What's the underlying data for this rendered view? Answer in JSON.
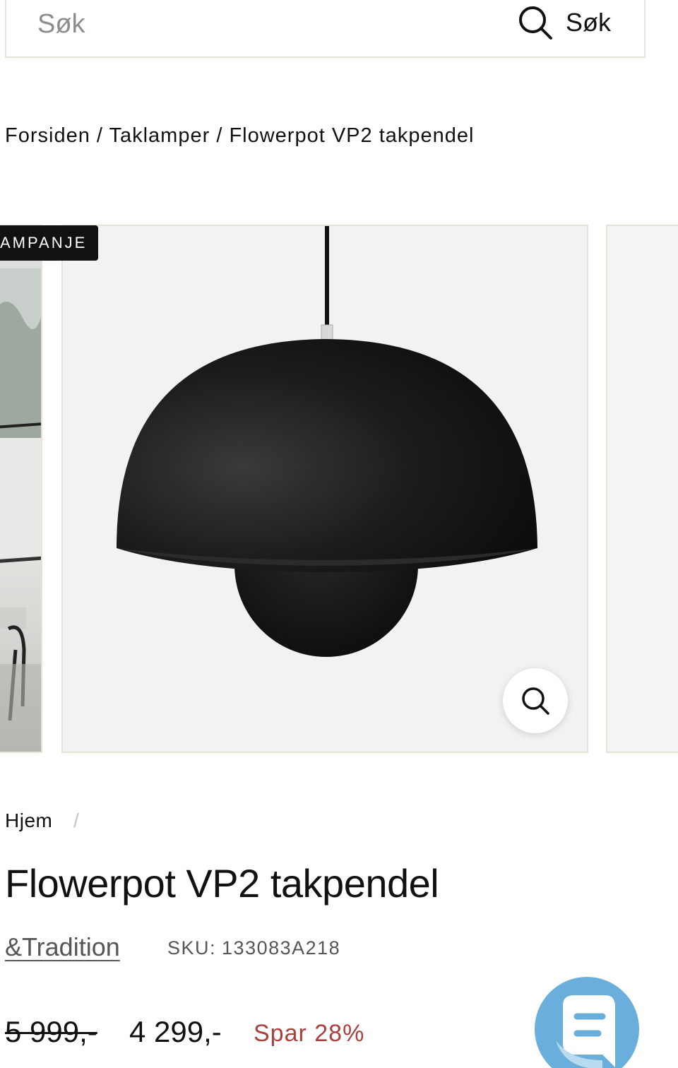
{
  "search": {
    "placeholder": "Søk",
    "button_label": "Søk"
  },
  "breadcrumb_top": {
    "items": [
      "Forsiden",
      "Taklamper",
      "Flowerpot VP2 takpendel"
    ],
    "separator": " / "
  },
  "gallery": {
    "badge": "AMPANJE",
    "zoom_icon": "zoom-icon"
  },
  "breadcrumb_product": {
    "home": "Hjem",
    "separator": "/"
  },
  "product": {
    "title": "Flowerpot VP2 takpendel",
    "brand": "&Tradition",
    "sku_label": "SKU:",
    "sku_value": "133083A218",
    "old_price": "5 999,-",
    "new_price": "4 299,-",
    "save_label": "Spar 28%"
  },
  "colors": {
    "save_red": "#a8403d",
    "chat_blue": "#6aaedb",
    "border_beige": "#e6e3d6"
  },
  "chat": {
    "icon": "chat-icon"
  }
}
